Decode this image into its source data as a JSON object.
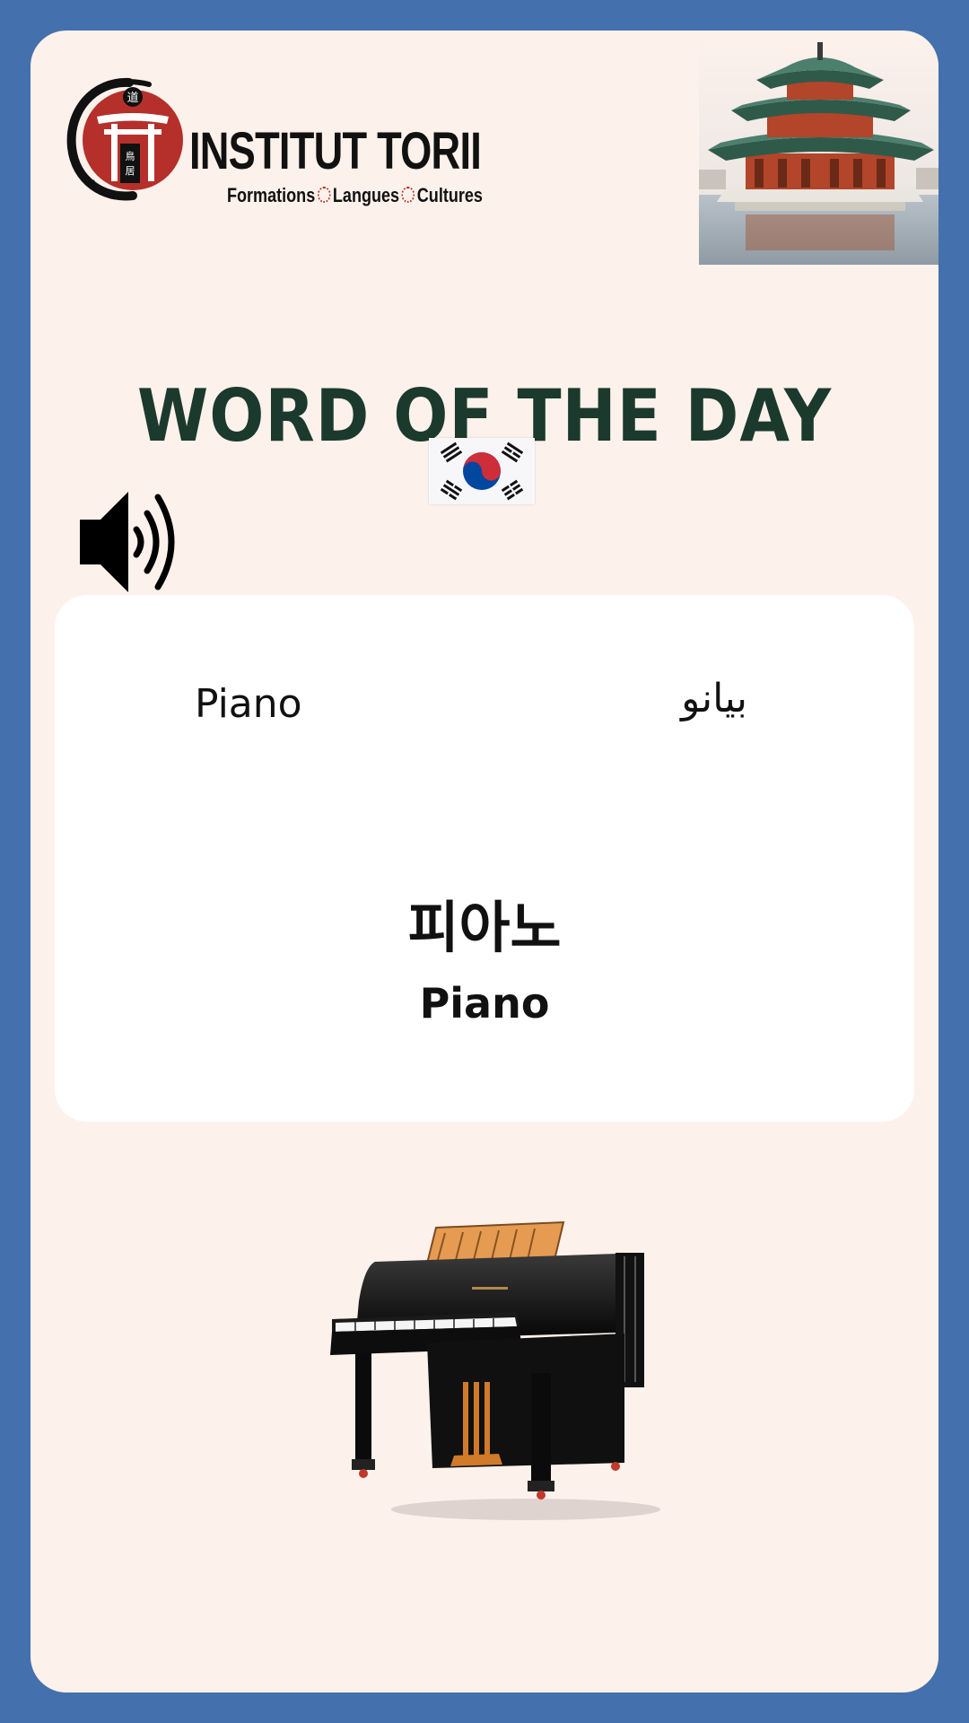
{
  "brand": {
    "name": "INSTITUT TORII",
    "tagline_parts": [
      "Formations",
      "Langues",
      "Cultures"
    ],
    "emblem_chars": [
      "道",
      "鳥",
      "居"
    ]
  },
  "header": {
    "title": "WORD OF THE DAY"
  },
  "flag": {
    "country": "South Korea",
    "icon": "korea-flag-icon"
  },
  "audio": {
    "icon": "speaker-icon"
  },
  "word": {
    "translation_latin": "Piano",
    "translation_arabic": "بيانو",
    "native": "피아노",
    "romanized": "Piano"
  },
  "illustration": {
    "icon": "grand-piano-illustration"
  },
  "colors": {
    "frame": "#4471ad",
    "background": "#fdf1eb",
    "card": "#ffffff",
    "title": "#1b3a2d",
    "brand_red": "#b5302b"
  }
}
